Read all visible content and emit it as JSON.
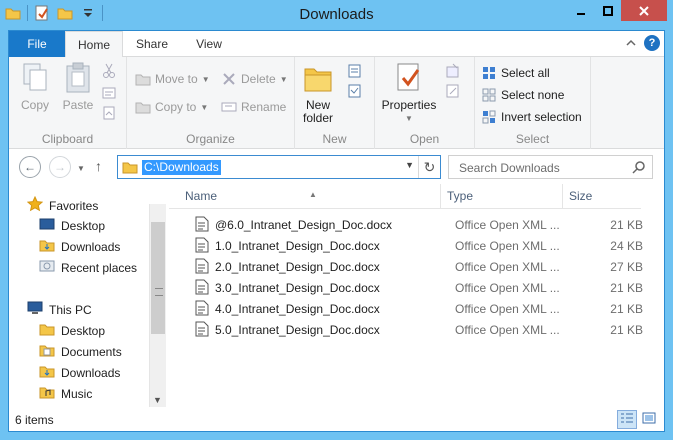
{
  "window": {
    "title": "Downloads"
  },
  "ribbon_tabs": {
    "file": "File",
    "home": "Home",
    "share": "Share",
    "view": "View"
  },
  "ribbon": {
    "clipboard": {
      "label": "Clipboard",
      "copy": "Copy",
      "paste": "Paste"
    },
    "organize": {
      "label": "Organize",
      "move_to": "Move to",
      "copy_to": "Copy to",
      "delete": "Delete",
      "rename": "Rename"
    },
    "new": {
      "label": "New",
      "new_folder_line1": "New",
      "new_folder_line2": "folder"
    },
    "open": {
      "label": "Open",
      "properties": "Properties"
    },
    "select": {
      "label": "Select",
      "select_all": "Select all",
      "select_none": "Select none",
      "invert_selection": "Invert selection"
    }
  },
  "address": {
    "path": "C:\\Downloads",
    "search_placeholder": "Search Downloads"
  },
  "nav_pane": {
    "favorites": "Favorites",
    "favorites_items": [
      "Desktop",
      "Downloads",
      "Recent places"
    ],
    "this_pc": "This PC",
    "this_pc_items": [
      "Desktop",
      "Documents",
      "Downloads",
      "Music"
    ]
  },
  "columns": {
    "name": "Name",
    "type": "Type",
    "size": "Size"
  },
  "files": [
    {
      "name": "@6.0_Intranet_Design_Doc.docx",
      "type": "Office Open XML ...",
      "size": "21 KB"
    },
    {
      "name": "1.0_Intranet_Design_Doc.docx",
      "type": "Office Open XML ...",
      "size": "24 KB"
    },
    {
      "name": "2.0_Intranet_Design_Doc.docx",
      "type": "Office Open XML ...",
      "size": "27 KB"
    },
    {
      "name": "3.0_Intranet_Design_Doc.docx",
      "type": "Office Open XML ...",
      "size": "21 KB"
    },
    {
      "name": "4.0_Intranet_Design_Doc.docx",
      "type": "Office Open XML ...",
      "size": "21 KB"
    },
    {
      "name": "5.0_Intranet_Design_Doc.docx",
      "type": "Office Open XML ...",
      "size": "21 KB"
    }
  ],
  "status": {
    "item_count": "6 items"
  },
  "colors": {
    "frame": "#6ec2f2",
    "file_tab": "#1979ca",
    "close_button": "#c7504c",
    "selection": "#3399ff"
  }
}
